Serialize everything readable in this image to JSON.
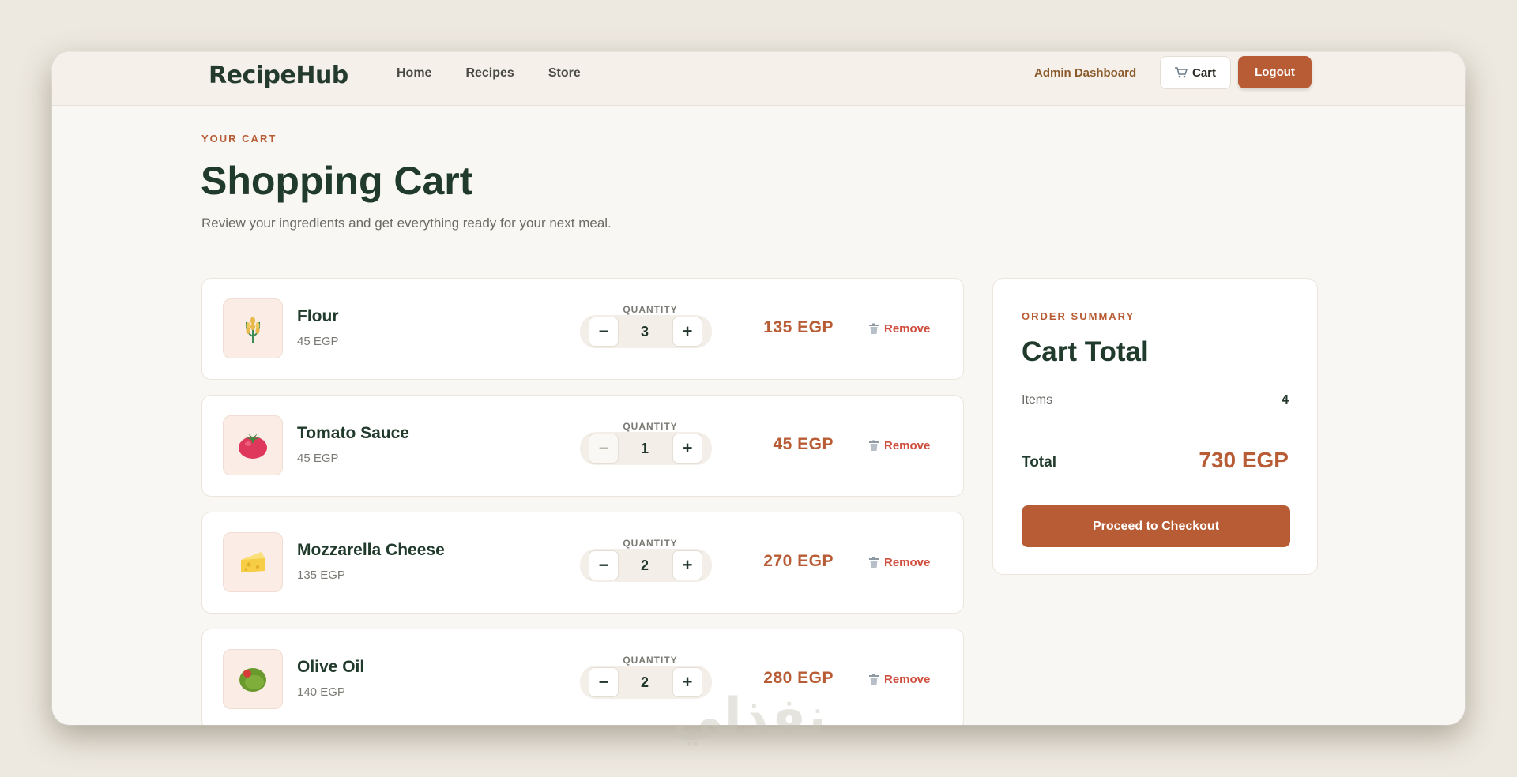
{
  "nav": {
    "brand": "RecipeHub",
    "links": [
      "Home",
      "Recipes",
      "Store"
    ],
    "admin": "Admin Dashboard",
    "cart": "Cart",
    "logout": "Logout"
  },
  "header": {
    "eyebrow": "YOUR CART",
    "title": "Shopping Cart",
    "subtitle": "Review your ingredients and get everything ready for your next meal."
  },
  "quantity_label": "QUANTITY",
  "remove_label": "Remove",
  "items": [
    {
      "name": "Flour",
      "unit_price": "45 EGP",
      "qty": "3",
      "total": "135 EGP",
      "icon": "wheat-icon"
    },
    {
      "name": "Tomato Sauce",
      "unit_price": "45 EGP",
      "qty": "1",
      "total": "45 EGP",
      "icon": "tomato-icon"
    },
    {
      "name": "Mozzarella Cheese",
      "unit_price": "135 EGP",
      "qty": "2",
      "total": "270 EGP",
      "icon": "cheese-icon"
    },
    {
      "name": "Olive Oil",
      "unit_price": "140 EGP",
      "qty": "2",
      "total": "280 EGP",
      "icon": "olive-icon"
    }
  ],
  "summary": {
    "eyebrow": "ORDER SUMMARY",
    "title": "Cart Total",
    "items_label": "Items",
    "items_value": "4",
    "total_label": "Total",
    "total_value": "730 EGP",
    "checkout": "Proceed to Checkout"
  },
  "watermark": "نفذلي",
  "colors": {
    "accent": "#b85c35",
    "heading": "#203a2c",
    "remove": "#cf4f3f",
    "background": "#f9f7f3"
  }
}
